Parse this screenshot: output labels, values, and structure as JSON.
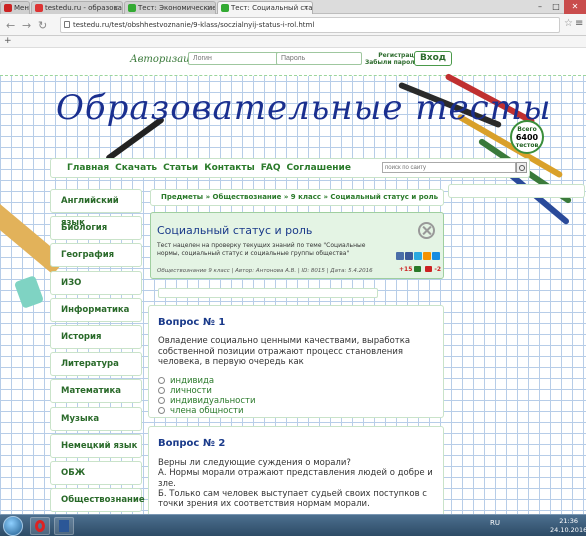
{
  "browser": {
    "tabs": [
      {
        "label": "Меню",
        "active": false
      },
      {
        "label": "testedu.ru - образовательн",
        "active": false
      },
      {
        "label": "Тест: Экономические сис",
        "active": false
      },
      {
        "label": "Тест: Социальный статус",
        "active": true
      }
    ],
    "url": "testedu.ru/test/obshhestvoznanie/9-klass/soczialnyij-status-i-rol.html",
    "window_controls": [
      "–",
      "□",
      "✕"
    ]
  },
  "auth": {
    "label": "Авторизация",
    "login_placeholder": "Логин",
    "password_placeholder": "Пароль",
    "register": "Регистрация",
    "forgot": "Забыли пароль?",
    "login_button": "Вход"
  },
  "site": {
    "logo": "Образовательные тесты",
    "badge_top": "Всего",
    "badge_count": "6400",
    "badge_bottom": "тестов"
  },
  "nav": {
    "items": [
      "Главная",
      "Скачать",
      "Статьи",
      "Контакты",
      "FAQ",
      "Соглашение"
    ],
    "search_placeholder": "поиск по сайту"
  },
  "sidebar": {
    "items": [
      "Английский язык",
      "Биология",
      "География",
      "ИЗО",
      "Информатика",
      "История",
      "Литература",
      "Математика",
      "Музыка",
      "Немецкий язык",
      "ОБЖ",
      "Обществознание"
    ]
  },
  "breadcrumb": "Предметы » Обществознание » 9 класс » Социальный статус и роль",
  "test": {
    "title": "Социальный статус и роль",
    "description": "Тест нацелен на проверку текущих знаний по теме \"Социальные нормы, социальный статус и социальные группы общества\"",
    "meta": "Обществознание 9 класс | Автор: Антонова А.В. | ID: 8015 | Дата: 5.4.2016",
    "votes_plus": "+15",
    "votes_minus": "-2"
  },
  "questions": [
    {
      "title": "Вопрос № 1",
      "text": "Овладение социально ценными качествами, выработка собственной позиции отражают процесс становления человека, в первую очередь как",
      "options": [
        "индивида",
        "личности",
        "индивидуальности",
        "члена общности"
      ]
    },
    {
      "title": "Вопрос № 2",
      "lines": [
        "Верны ли следующие суждения о морали?",
        "А. Нормы морали отражают представления людей о добре и зле.",
        "Б. Только сам человек выступает судьей своих поступков с точки зрения их соответствия нормам морали."
      ]
    }
  ],
  "taskbar": {
    "lang": "RU",
    "time": "21:36",
    "date": "24.10.2016"
  },
  "colors": {
    "accent_green": "#2a7a2a",
    "title_blue": "#1a3a8a",
    "grid_blue": "#b7cde8"
  }
}
